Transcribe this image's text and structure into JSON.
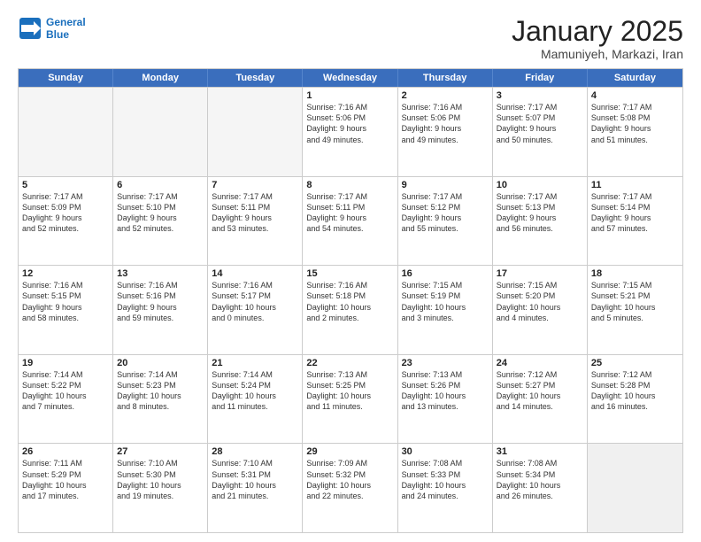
{
  "header": {
    "logo_line1": "General",
    "logo_line2": "Blue",
    "month": "January 2025",
    "location": "Mamuniyeh, Markazi, Iran"
  },
  "days_of_week": [
    "Sunday",
    "Monday",
    "Tuesday",
    "Wednesday",
    "Thursday",
    "Friday",
    "Saturday"
  ],
  "rows": [
    [
      {
        "num": "",
        "text": "",
        "empty": true
      },
      {
        "num": "",
        "text": "",
        "empty": true
      },
      {
        "num": "",
        "text": "",
        "empty": true
      },
      {
        "num": "1",
        "text": "Sunrise: 7:16 AM\nSunset: 5:06 PM\nDaylight: 9 hours\nand 49 minutes."
      },
      {
        "num": "2",
        "text": "Sunrise: 7:16 AM\nSunset: 5:06 PM\nDaylight: 9 hours\nand 49 minutes."
      },
      {
        "num": "3",
        "text": "Sunrise: 7:17 AM\nSunset: 5:07 PM\nDaylight: 9 hours\nand 50 minutes."
      },
      {
        "num": "4",
        "text": "Sunrise: 7:17 AM\nSunset: 5:08 PM\nDaylight: 9 hours\nand 51 minutes."
      }
    ],
    [
      {
        "num": "5",
        "text": "Sunrise: 7:17 AM\nSunset: 5:09 PM\nDaylight: 9 hours\nand 52 minutes."
      },
      {
        "num": "6",
        "text": "Sunrise: 7:17 AM\nSunset: 5:10 PM\nDaylight: 9 hours\nand 52 minutes."
      },
      {
        "num": "7",
        "text": "Sunrise: 7:17 AM\nSunset: 5:11 PM\nDaylight: 9 hours\nand 53 minutes."
      },
      {
        "num": "8",
        "text": "Sunrise: 7:17 AM\nSunset: 5:11 PM\nDaylight: 9 hours\nand 54 minutes."
      },
      {
        "num": "9",
        "text": "Sunrise: 7:17 AM\nSunset: 5:12 PM\nDaylight: 9 hours\nand 55 minutes."
      },
      {
        "num": "10",
        "text": "Sunrise: 7:17 AM\nSunset: 5:13 PM\nDaylight: 9 hours\nand 56 minutes."
      },
      {
        "num": "11",
        "text": "Sunrise: 7:17 AM\nSunset: 5:14 PM\nDaylight: 9 hours\nand 57 minutes."
      }
    ],
    [
      {
        "num": "12",
        "text": "Sunrise: 7:16 AM\nSunset: 5:15 PM\nDaylight: 9 hours\nand 58 minutes."
      },
      {
        "num": "13",
        "text": "Sunrise: 7:16 AM\nSunset: 5:16 PM\nDaylight: 9 hours\nand 59 minutes."
      },
      {
        "num": "14",
        "text": "Sunrise: 7:16 AM\nSunset: 5:17 PM\nDaylight: 10 hours\nand 0 minutes."
      },
      {
        "num": "15",
        "text": "Sunrise: 7:16 AM\nSunset: 5:18 PM\nDaylight: 10 hours\nand 2 minutes."
      },
      {
        "num": "16",
        "text": "Sunrise: 7:15 AM\nSunset: 5:19 PM\nDaylight: 10 hours\nand 3 minutes."
      },
      {
        "num": "17",
        "text": "Sunrise: 7:15 AM\nSunset: 5:20 PM\nDaylight: 10 hours\nand 4 minutes."
      },
      {
        "num": "18",
        "text": "Sunrise: 7:15 AM\nSunset: 5:21 PM\nDaylight: 10 hours\nand 5 minutes."
      }
    ],
    [
      {
        "num": "19",
        "text": "Sunrise: 7:14 AM\nSunset: 5:22 PM\nDaylight: 10 hours\nand 7 minutes."
      },
      {
        "num": "20",
        "text": "Sunrise: 7:14 AM\nSunset: 5:23 PM\nDaylight: 10 hours\nand 8 minutes."
      },
      {
        "num": "21",
        "text": "Sunrise: 7:14 AM\nSunset: 5:24 PM\nDaylight: 10 hours\nand 11 minutes."
      },
      {
        "num": "22",
        "text": "Sunrise: 7:13 AM\nSunset: 5:25 PM\nDaylight: 10 hours\nand 11 minutes."
      },
      {
        "num": "23",
        "text": "Sunrise: 7:13 AM\nSunset: 5:26 PM\nDaylight: 10 hours\nand 13 minutes."
      },
      {
        "num": "24",
        "text": "Sunrise: 7:12 AM\nSunset: 5:27 PM\nDaylight: 10 hours\nand 14 minutes."
      },
      {
        "num": "25",
        "text": "Sunrise: 7:12 AM\nSunset: 5:28 PM\nDaylight: 10 hours\nand 16 minutes."
      }
    ],
    [
      {
        "num": "26",
        "text": "Sunrise: 7:11 AM\nSunset: 5:29 PM\nDaylight: 10 hours\nand 17 minutes."
      },
      {
        "num": "27",
        "text": "Sunrise: 7:10 AM\nSunset: 5:30 PM\nDaylight: 10 hours\nand 19 minutes."
      },
      {
        "num": "28",
        "text": "Sunrise: 7:10 AM\nSunset: 5:31 PM\nDaylight: 10 hours\nand 21 minutes."
      },
      {
        "num": "29",
        "text": "Sunrise: 7:09 AM\nSunset: 5:32 PM\nDaylight: 10 hours\nand 22 minutes."
      },
      {
        "num": "30",
        "text": "Sunrise: 7:08 AM\nSunset: 5:33 PM\nDaylight: 10 hours\nand 24 minutes."
      },
      {
        "num": "31",
        "text": "Sunrise: 7:08 AM\nSunset: 5:34 PM\nDaylight: 10 hours\nand 26 minutes."
      },
      {
        "num": "",
        "text": "",
        "empty": true,
        "shaded": true
      }
    ]
  ]
}
